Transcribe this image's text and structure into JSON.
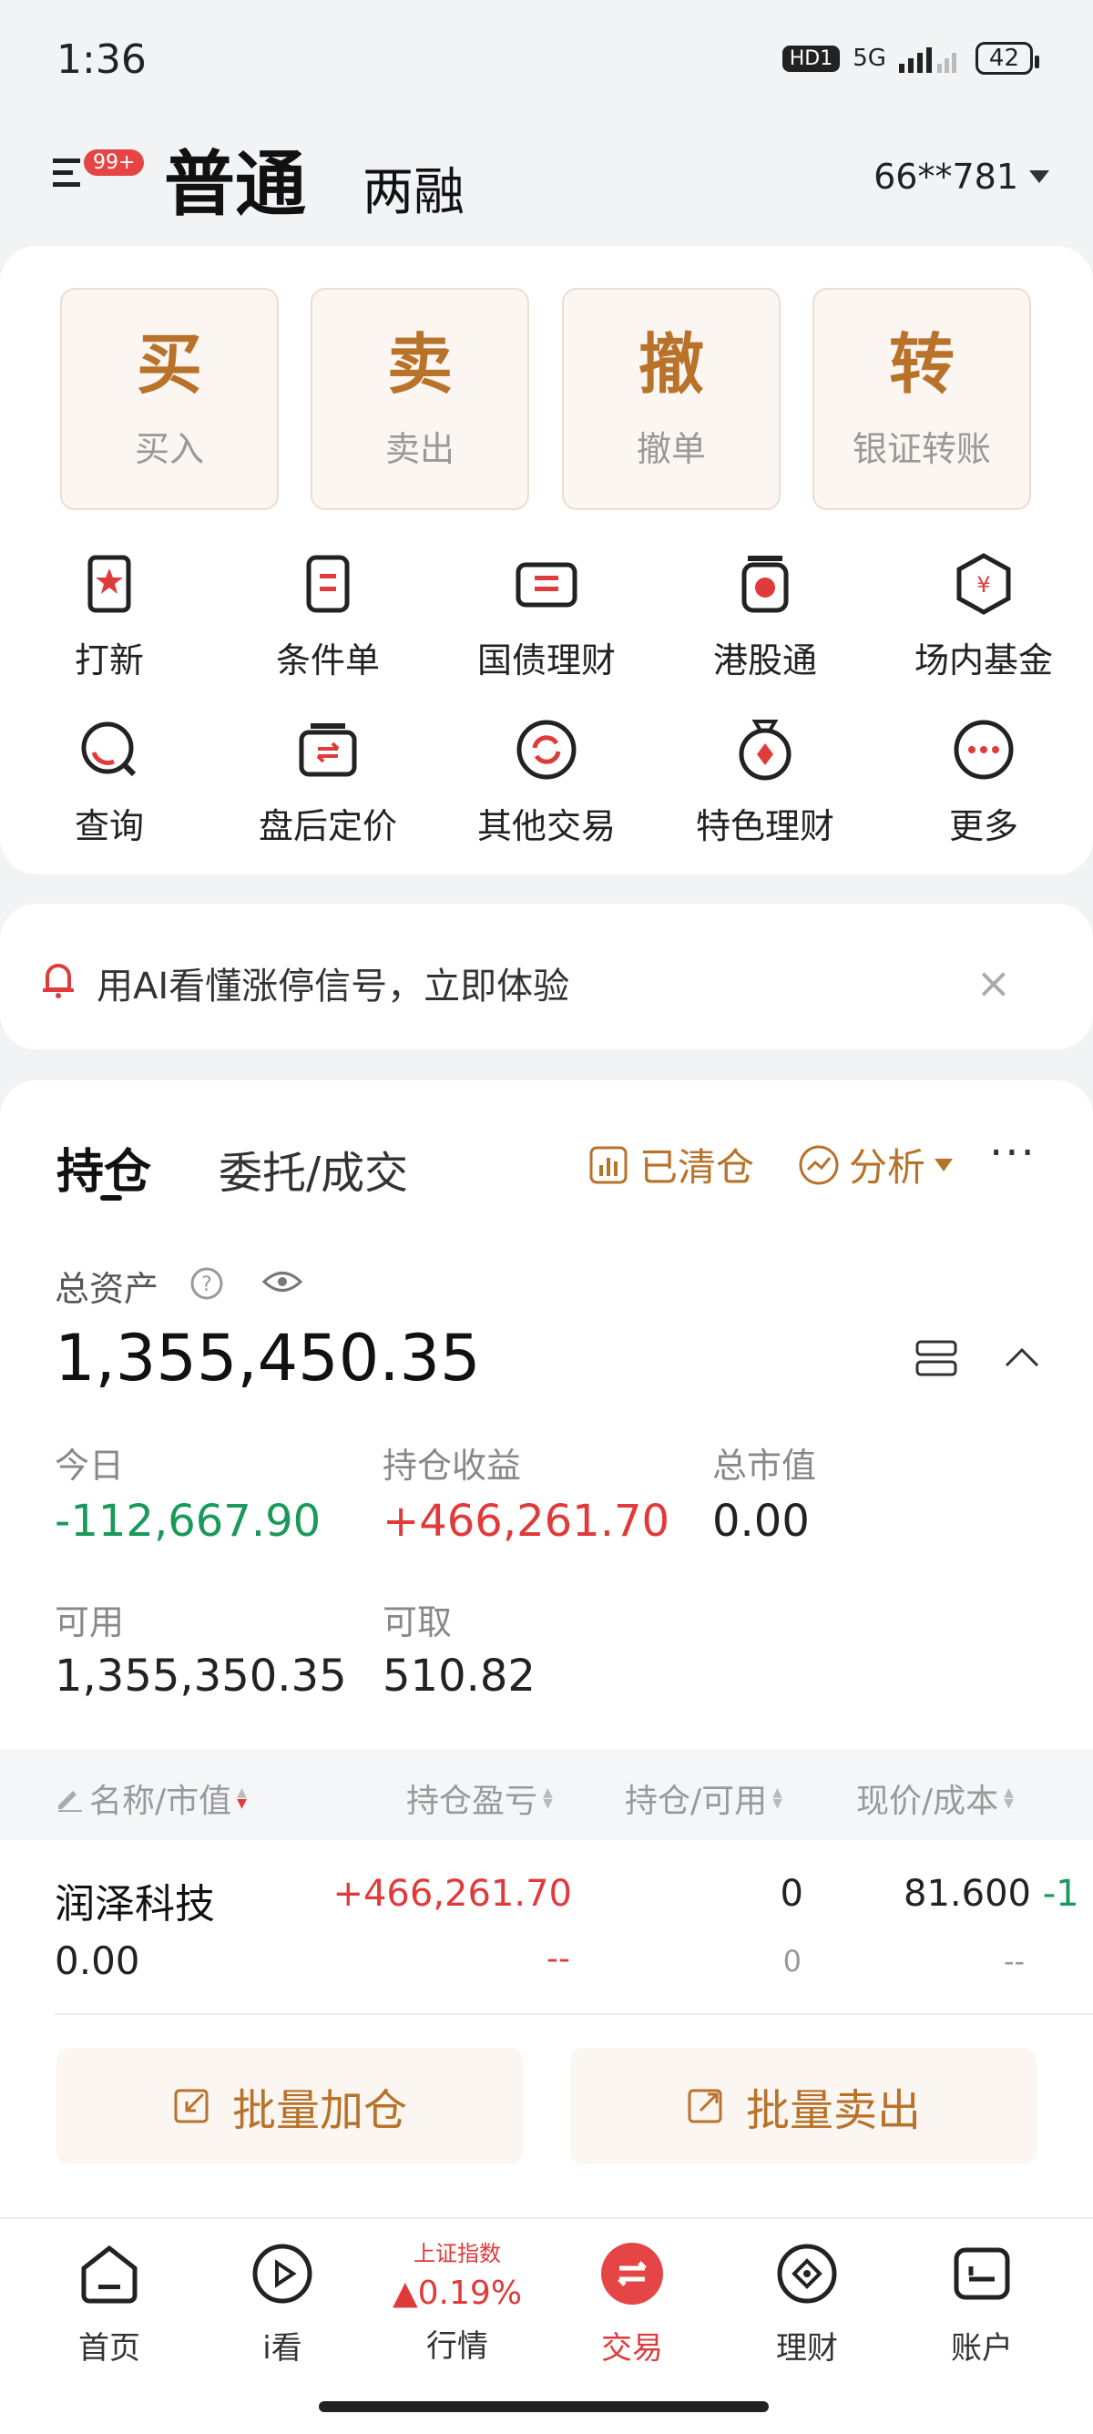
{
  "status_bar": {
    "time": "1:36",
    "hd_label": "HD1",
    "network": "5G",
    "battery": "42"
  },
  "header": {
    "badge": "99+",
    "tab_ordinary": "普通",
    "tab_margin": "两融",
    "account": "66**781"
  },
  "quick_actions": [
    {
      "main": "买",
      "sub": "买入"
    },
    {
      "main": "卖",
      "sub": "卖出"
    },
    {
      "main": "撤",
      "sub": "撤单"
    },
    {
      "main": "转",
      "sub": "银证转账"
    }
  ],
  "grid": [
    {
      "label": "打新",
      "icon": "ipo-icon"
    },
    {
      "label": "条件单",
      "icon": "condition-order-icon"
    },
    {
      "label": "国债理财",
      "icon": "bond-icon"
    },
    {
      "label": "港股通",
      "icon": "hk-connect-icon"
    },
    {
      "label": "场内基金",
      "icon": "fund-icon"
    },
    {
      "label": "查询",
      "icon": "query-icon"
    },
    {
      "label": "盘后定价",
      "icon": "after-hours-icon"
    },
    {
      "label": "其他交易",
      "icon": "other-trade-icon"
    },
    {
      "label": "特色理财",
      "icon": "featured-finance-icon"
    },
    {
      "label": "更多",
      "icon": "more-icon"
    }
  ],
  "notice": {
    "text": "用AI看懂涨停信号，立即体验",
    "close": "×"
  },
  "position_tabs": {
    "hold": "持仓",
    "orders": "委托/成交",
    "cleared": "已清仓",
    "analysis": "分析",
    "more": "···"
  },
  "assets": {
    "total_label": "总资产",
    "total_value": "1,355,450.35",
    "today_label": "今日",
    "today_value": "-112,667.90",
    "profit_label": "持仓收益",
    "profit_value": "+466,261.70",
    "market_label": "总市值",
    "market_value": "0.00",
    "available_label": "可用",
    "available_value": "1,355,350.35",
    "withdrawable_label": "可取",
    "withdrawable_value": "510.82"
  },
  "table": {
    "headers": [
      "名称/市值",
      "持仓盈亏",
      "持仓/可用",
      "现价/成本"
    ],
    "rows": [
      {
        "name": "润泽科技",
        "market_value": "0.00",
        "pl": "+466,261.70",
        "pl_pct": "--",
        "hold": "0",
        "available": "0",
        "price": "81.600",
        "price_change": "-1",
        "cost": "--"
      }
    ]
  },
  "batch": {
    "add": "批量加仓",
    "sell": "批量卖出"
  },
  "bottom_nav": {
    "home": "首页",
    "watch": "i看",
    "index_name": "上证指数",
    "index_value": "0.19%",
    "market": "行情",
    "trade": "交易",
    "finance": "理财",
    "account": "账户"
  },
  "colors": {
    "accent_gold": "#b8722a",
    "red": "#e03a3a",
    "green": "#1a9a5a"
  }
}
